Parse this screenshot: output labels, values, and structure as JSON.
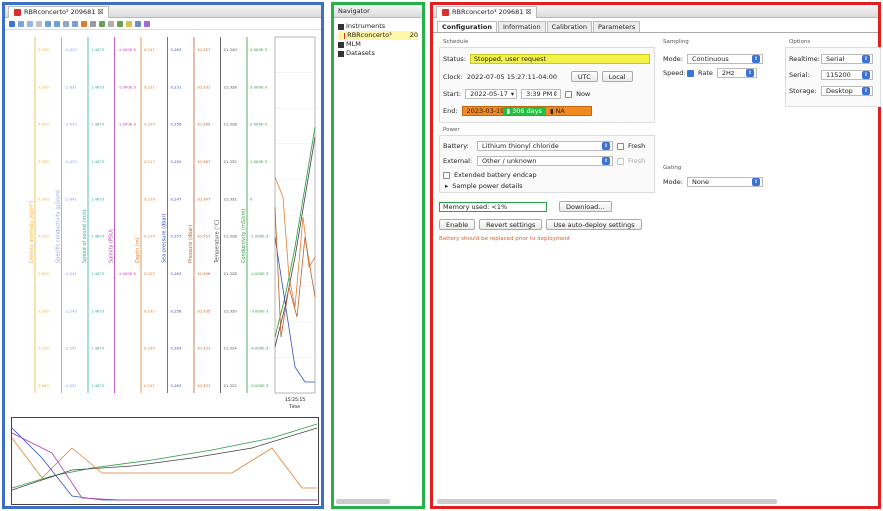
{
  "left_panel": {
    "tab_title": "RBRconcerto³ 209681 ☒",
    "axes": [
      {
        "title": "Density anomaly (kg/m³)",
        "color": "#f2b230",
        "ticks": [
          "5.180",
          "3.180",
          "4.000",
          "3.180",
          "5.340",
          "3.100",
          "3.950",
          "3.180",
          "3.190",
          "3.960"
        ]
      },
      {
        "title": "Specific conductivity (µS/cm)",
        "color": "#8b9be8",
        "ticks": [
          "-2.623",
          "-2.631",
          "-2.633",
          "-2.633",
          "-2.641",
          "",
          "-2.541",
          "-2.543",
          "-2.551",
          "-2.551"
        ]
      },
      {
        "title": "Speed of sound (m/s)",
        "color": "#2db09a",
        "ticks": [
          "1.4873",
          "1.4873",
          "1.4873",
          "1.4873",
          "1.4873",
          "1.4873",
          "1.4873",
          "1.4873",
          "1.4873",
          "1.4873"
        ]
      },
      {
        "title": "Salinity (PSU)",
        "color": "#b03cb0",
        "ticks": [
          "-1.000E-3",
          "-1.000E-3",
          "-1.000E-3",
          "",
          "",
          "",
          "-1.000E-3",
          "",
          "",
          ""
        ]
      },
      {
        "title": "Depth (m)",
        "color": "#e08030",
        "ticks": [
          "0.241",
          "0.221",
          "0.220",
          "0.217",
          "0.216",
          "0.214",
          "0.225",
          "0.192",
          "0.190",
          "0.191"
        ]
      },
      {
        "title": "Sea pressure (dbar)",
        "color": "#3050c0",
        "ticks": [
          "0.263",
          "0.231",
          "0.256",
          "0.250",
          "0.247",
          "0.257",
          "0.263",
          "0.258",
          "0.263",
          "0.263"
        ]
      },
      {
        "title": "Pressure (dbar)",
        "color": "#c06030",
        "ticks": [
          "10.357",
          "10.331",
          "10.369",
          "10.367",
          "10.347",
          "10.357",
          "10.396",
          "10.335",
          "10.331",
          "10.331"
        ]
      },
      {
        "title": "Temperature (°C)",
        "color": "#444444",
        "ticks": [
          "21.340",
          "21.328",
          "21.328",
          "21.332",
          "21.332",
          "21.328",
          "21.328",
          "21.320",
          "21.324",
          "21.322"
        ]
      },
      {
        "title": "Conductivity (mS/cm)",
        "color": "#2a9a40",
        "ticks": [
          "4.000E-3",
          "3.000E-3",
          "2.000E-3",
          "1.000E-3",
          "0",
          "-1.000E-3",
          "-2.000E-3",
          "-3.000E-3",
          "-4.000E-3",
          "-5.000E-3"
        ]
      }
    ],
    "time_label": "15:25:15",
    "time_axis_title": "Time"
  },
  "navigator": {
    "title": "Navigator",
    "items": [
      {
        "label": "Instruments",
        "level": 0
      },
      {
        "label": "RBRconcerto³",
        "suffix": "20",
        "level": 1,
        "selected": true
      },
      {
        "label": "MLM",
        "level": 0
      },
      {
        "label": "Datasets",
        "level": 0
      }
    ]
  },
  "config": {
    "tab_title": "RBRconcerto³ 209681 ☒",
    "tabs": [
      "Configuration",
      "Information",
      "Calibration",
      "Parameters"
    ],
    "schedule": {
      "title": "Schedule",
      "status_label": "Status:",
      "status_value": "Stopped, user request",
      "clock_label": "Clock:",
      "clock_value": "2022-07-05 15:27:11-04:00",
      "utc_btn": "UTC",
      "local_btn": "Local",
      "start_label": "Start:",
      "start_date": "2022-05-17",
      "start_time": "3:39 PM",
      "now_label": "Now",
      "end_label": "End:",
      "end_date": "2023-03-19",
      "end_days": "306 days",
      "end_na": "NA"
    },
    "power": {
      "title": "Power",
      "battery_label": "Battery:",
      "battery_value": "Lithium thionyl chloride",
      "fresh_label": "Fresh",
      "external_label": "External:",
      "external_value": "Other / unknown",
      "fresh2_label": "Fresh",
      "extended_label": "Extended battery endcap",
      "sample_label": "Sample power details"
    },
    "memory_label": "Memory used: <1%",
    "download_btn": "Download...",
    "enable_btn": "Enable",
    "revert_btn": "Revert settings",
    "autodeploy_btn": "Use auto-deploy settings",
    "warning": "Battery should be replaced prior to deployment",
    "sampling": {
      "title": "Sampling",
      "mode_label": "Mode:",
      "mode_value": "Continuous",
      "speed_label": "Speed:",
      "rate_label": "Rate",
      "rate_value": "2Hz"
    },
    "gating": {
      "title": "Gating",
      "mode_label": "Mode:",
      "mode_value": "None"
    },
    "options": {
      "title": "Options",
      "realtime_label": "Realtime:",
      "realtime_value": "Serial",
      "serial_label": "Serial:",
      "serial_value": "115200",
      "storage_label": "Storage:",
      "storage_value": "Desktop"
    }
  }
}
